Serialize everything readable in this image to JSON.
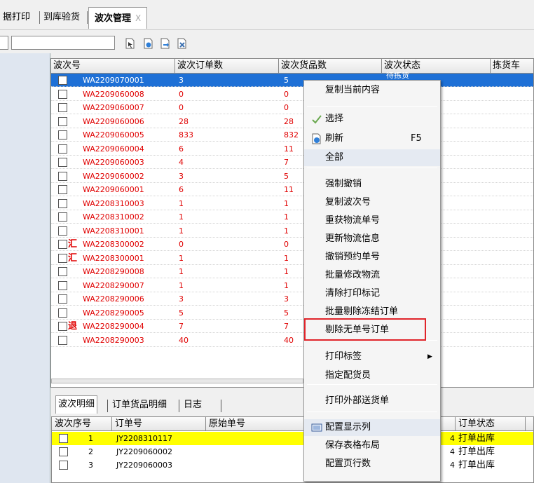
{
  "tabs": [
    {
      "label": "据打印"
    },
    {
      "label": "到库验货"
    },
    {
      "label": "波次管理",
      "close": "X"
    }
  ],
  "toolbar": {
    "prefix_value": "",
    "search_value": ""
  },
  "grid": {
    "columns": [
      "波次号",
      "波次订单数",
      "波次货品数",
      "波次状态",
      "拣货车"
    ],
    "rows": [
      {
        "wave": "WA2209070001",
        "orders": "3",
        "items": "5",
        "status": "待拣货",
        "mark": ""
      },
      {
        "wave": "WA2209060008",
        "orders": "0",
        "items": "0",
        "status": "",
        "mark": ""
      },
      {
        "wave": "WA2209060007",
        "orders": "0",
        "items": "0",
        "status": "",
        "mark": ""
      },
      {
        "wave": "WA2209060006",
        "orders": "28",
        "items": "28",
        "status": "",
        "mark": ""
      },
      {
        "wave": "WA2209060005",
        "orders": "833",
        "items": "832",
        "status": "",
        "mark": ""
      },
      {
        "wave": "WA2209060004",
        "orders": "6",
        "items": "11",
        "status": "",
        "mark": ""
      },
      {
        "wave": "WA2209060003",
        "orders": "4",
        "items": "7",
        "status": "",
        "mark": ""
      },
      {
        "wave": "WA2209060002",
        "orders": "3",
        "items": "5",
        "status": "",
        "mark": ""
      },
      {
        "wave": "WA2209060001",
        "orders": "6",
        "items": "11",
        "status": "",
        "mark": ""
      },
      {
        "wave": "WA2208310003",
        "orders": "1",
        "items": "1",
        "status": "",
        "mark": ""
      },
      {
        "wave": "WA2208310002",
        "orders": "1",
        "items": "1",
        "status": "",
        "mark": ""
      },
      {
        "wave": "WA2208310001",
        "orders": "1",
        "items": "1",
        "status": "",
        "mark": ""
      },
      {
        "wave": "WA2208300002",
        "orders": "0",
        "items": "0",
        "status": "",
        "mark": "汇"
      },
      {
        "wave": "WA2208300001",
        "orders": "1",
        "items": "1",
        "status": "",
        "mark": "汇"
      },
      {
        "wave": "WA2208290008",
        "orders": "1",
        "items": "1",
        "status": "",
        "mark": ""
      },
      {
        "wave": "WA2208290007",
        "orders": "1",
        "items": "1",
        "status": "",
        "mark": ""
      },
      {
        "wave": "WA2208290006",
        "orders": "3",
        "items": "3",
        "status": "",
        "mark": ""
      },
      {
        "wave": "WA2208290005",
        "orders": "5",
        "items": "5",
        "status": "",
        "mark": ""
      },
      {
        "wave": "WA2208290004",
        "orders": "7",
        "items": "7",
        "status": "",
        "mark": "退"
      },
      {
        "wave": "WA2208290003",
        "orders": "40",
        "items": "40",
        "status": "",
        "mark": ""
      }
    ]
  },
  "bottom_tabs": [
    "波次明细",
    "订单货品明细",
    "日志"
  ],
  "detail": {
    "columns": [
      "波次序号",
      "订单号",
      "原始单号",
      "订单状态"
    ],
    "rows": [
      {
        "seq": "1",
        "order_no": "JY2208310117",
        "orig": "",
        "state_prefix": "4",
        "state": "打单出库"
      },
      {
        "seq": "2",
        "order_no": "JY2209060002",
        "orig": "",
        "state_prefix": "4",
        "state": "打单出库"
      },
      {
        "seq": "3",
        "order_no": "JY2209060003",
        "orig": "",
        "state_prefix": "4",
        "state": "打单出库"
      }
    ]
  },
  "context_menu": {
    "items": [
      {
        "label": "复制当前内容"
      },
      {
        "label": "选择",
        "icon": "check-icon"
      },
      {
        "label": "刷新",
        "shortcut": "F5",
        "icon": "refresh-icon"
      },
      {
        "label": "全部"
      },
      {
        "label": "强制撤销"
      },
      {
        "label": "复制波次号"
      },
      {
        "label": "重获物流单号"
      },
      {
        "label": "更新物流信息"
      },
      {
        "label": "撤销预约单号"
      },
      {
        "label": "批量修改物流"
      },
      {
        "label": "清除打印标记"
      },
      {
        "label": "批量剔除冻结订单"
      },
      {
        "label": "剔除无单号订单"
      },
      {
        "label": "打印标签",
        "submenu": "▶"
      },
      {
        "label": "指定配货员"
      },
      {
        "label": "打印外部送货单"
      },
      {
        "label": "配置显示列",
        "icon": "columns-icon"
      },
      {
        "label": "保存表格布局"
      },
      {
        "label": "配置页行数"
      }
    ]
  },
  "colors": {
    "selection": "#1e70d6",
    "red_text": "#e00000",
    "highlight_row": "#ffff00",
    "annotation_box": "#e0242a"
  }
}
